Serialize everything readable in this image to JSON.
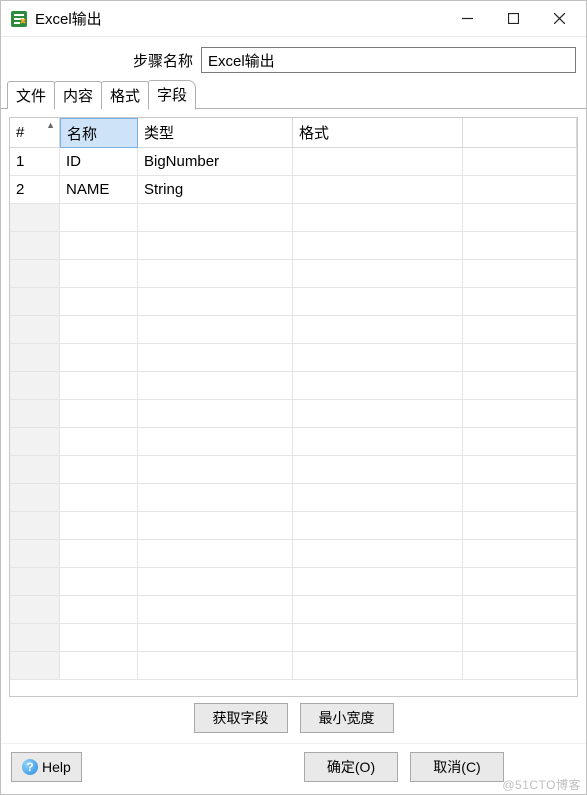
{
  "window": {
    "title": "Excel输出"
  },
  "form": {
    "step_name_label": "步骤名称",
    "step_name_value": "Excel输出"
  },
  "tabs": {
    "items": [
      {
        "label": "文件"
      },
      {
        "label": "内容"
      },
      {
        "label": "格式"
      },
      {
        "label": "字段"
      }
    ],
    "active_index": 3
  },
  "grid": {
    "columns": [
      {
        "label": "#"
      },
      {
        "label": "名称"
      },
      {
        "label": "类型"
      },
      {
        "label": "格式"
      },
      {
        "label": ""
      }
    ],
    "rows": [
      {
        "num": "1",
        "name": "ID",
        "type": "BigNumber",
        "format": ""
      },
      {
        "num": "2",
        "name": "NAME",
        "type": "String",
        "format": ""
      }
    ]
  },
  "buttons": {
    "get_fields": "获取字段",
    "min_width": "最小宽度",
    "help": "Help",
    "ok": "确定(O)",
    "cancel": "取消(C)"
  },
  "watermark": "@51CTO博客"
}
